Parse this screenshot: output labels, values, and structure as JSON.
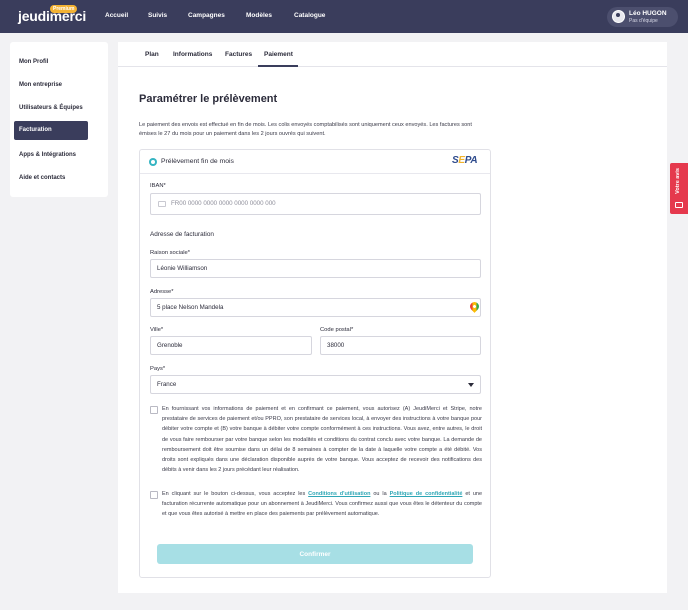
{
  "brand": {
    "name": "jeudimerci",
    "badge": "Premium"
  },
  "nav": {
    "items": [
      "Accueil",
      "Suivis",
      "Campagnes",
      "Modèles",
      "Catalogue"
    ]
  },
  "user": {
    "name": "Léo HUGON",
    "team": "Pas d'équipe"
  },
  "sidebar": {
    "items": [
      "Mon Profil",
      "Mon entreprise",
      "Utilisateurs & Équipes",
      "Facturation",
      "Apps & Intégrations",
      "Aide et contacts"
    ],
    "active": "Facturation"
  },
  "tabs": {
    "items": [
      "Plan",
      "Informations",
      "Factures",
      "Paiement"
    ],
    "active": "Paiement"
  },
  "page": {
    "title": "Paramétrer le prélèvement",
    "intro": "Le paiement des envois est effectué en fin de mois. Les colis envoyés comptabilisés sont uniquement ceux envoyés. Les factures sont émises le 27 du mois pour un paiement dans les 2 jours ouvrés qui suivent."
  },
  "payment": {
    "method_label": "Prélèvement fin de mois",
    "logo_text": {
      "s": "S",
      "e": "E",
      "pa": "PA"
    },
    "iban_label": "IBAN*",
    "iban_placeholder": "FR00 0000 0000 0000 0000 0000 000",
    "billing_heading": "Adresse de facturation",
    "company_label": "Raison sociale*",
    "company_value": "Léonie Williamson",
    "address_label": "Adresse*",
    "address_value": "5 place Nelson Mandela",
    "city_label": "Ville*",
    "city_value": "Grenoble",
    "zip_label": "Code postal*",
    "zip_value": "38000",
    "country_label": "Pays*",
    "country_value": "France"
  },
  "legal": {
    "mandate_text": "En fournissant vos informations de paiement et en confirmant ce paiement, vous autorisez (A) JeudiMerci et Stripe, notre prestataire de services de paiement et/ou PPRO, son prestataire de services local, à envoyer des instructions à votre banque pour débiter votre compte et (B) votre banque à débiter votre compte conformément à ces instructions. Vous avez, entre autres, le droit de vous faire rembourser par votre banque selon les modalités et conditions du contrat conclu avec votre banque. La demande de remboursement doit être soumise dans un délai de 8 semaines à compter de la date à laquelle votre compte a été débité. Vos droits sont expliqués dans une déclaration disponible auprès de votre banque. Vous acceptez de recevoir des notifications des débits à venir dans les 2 jours précédant leur réalisation.",
    "terms_prefix": "En cliquant sur le bouton ci-dessus, vous acceptez les ",
    "terms_link": "Conditions d'utilisation",
    "terms_middle": " ou la ",
    "privacy_link": "Politique de confidentialité",
    "terms_suffix": " et une facturation récurrente automatique pour un abonnement à JeudiMerci. Vous confirmez aussi que vous êtes le détenteur du compte et que vous êtes autorisé à mettre en place des paiements par prélèvement automatique."
  },
  "actions": {
    "confirm_label": "Confirmer"
  },
  "feedback": {
    "label": "Votre avis"
  },
  "colors": {
    "header": "#3a3d5c",
    "accent": "#35b4c2",
    "button_disabled": "#a7dfe5",
    "feedback": "#e5394d"
  }
}
